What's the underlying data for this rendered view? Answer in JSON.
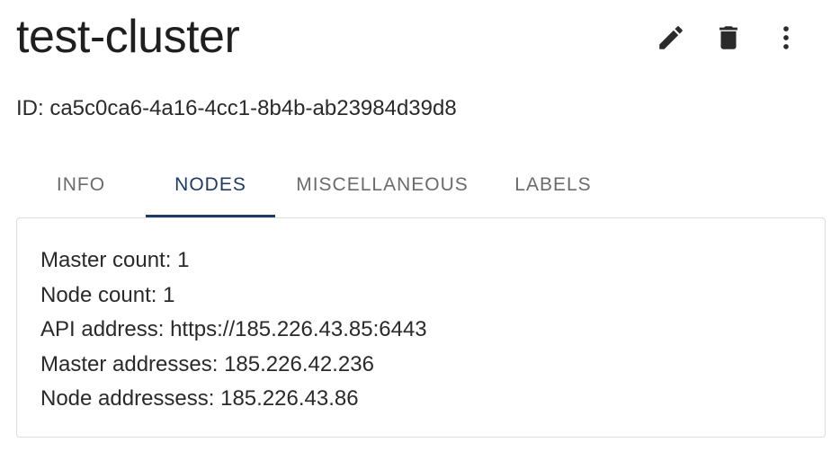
{
  "header": {
    "title": "test-cluster",
    "id_label": "ID: ca5c0ca6-4a16-4cc1-8b4b-ab23984d39d8"
  },
  "actions": {
    "edit_icon": "pencil-icon",
    "delete_icon": "trash-icon",
    "more_icon": "more-vert-icon"
  },
  "tabs": [
    {
      "label": "INFO",
      "active": false
    },
    {
      "label": "NODES",
      "active": true
    },
    {
      "label": "MISCELLANEOUS",
      "active": false
    },
    {
      "label": "LABELS",
      "active": false
    }
  ],
  "nodes_panel": {
    "master_count": "Master count: 1",
    "node_count": "Node count: 1",
    "api_address": "API address: https://185.226.43.85:6443",
    "master_addresses": "Master addresses: 185.226.42.236",
    "node_addresses": "Node addressess: 185.226.43.86"
  },
  "colors": {
    "active_tab": "#1f3a66",
    "inactive_tab": "#6b6b6b",
    "panel_border": "#dedede"
  }
}
